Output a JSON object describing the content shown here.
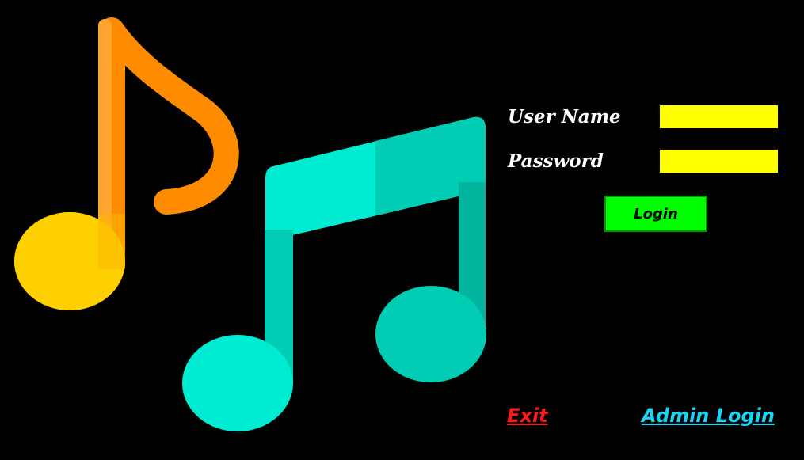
{
  "form": {
    "username_label": "User Name",
    "username_value": "",
    "password_label": "Password",
    "password_value": "",
    "login_label": "Login"
  },
  "links": {
    "exit_label": "Exit",
    "admin_login_label": "Admin Login"
  },
  "decoration": {
    "icon": "music-notes-icon",
    "colors": {
      "background": "#000000",
      "input_fill": "#ffff00",
      "login_button": "#00ff00",
      "exit_link": "#ff1a1a",
      "admin_link": "#19d4f2",
      "eighth_note_stem": "#ff8c00",
      "eighth_note_head": "#ffd000",
      "beamed_note": "#00e0c8"
    }
  }
}
